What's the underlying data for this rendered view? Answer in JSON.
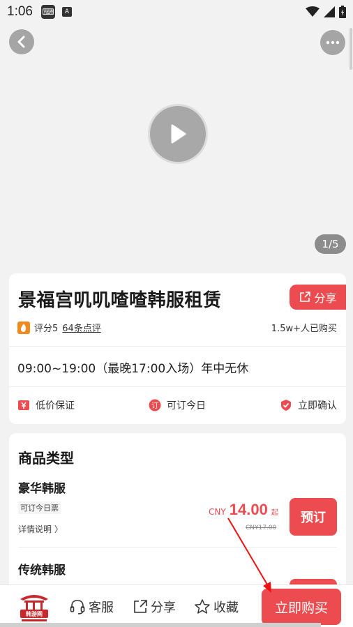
{
  "status_bar": {
    "time": "1:06",
    "icons": [
      "keyboard-icon",
      "a-icon"
    ],
    "right_icons": [
      "wifi-icon",
      "signal-icon",
      "battery-icon"
    ]
  },
  "media": {
    "page_indicator": "1/5"
  },
  "info": {
    "title": "景福宫叽叽喳喳韩服租赁",
    "share_label": "分享",
    "rating": "评分5",
    "reviews": "64条点评",
    "sold": "1.5w+人已购买",
    "hours": "09:00~19:00（最晚17:00入场）年中无休",
    "guarantees": [
      "低价保证",
      "可订今日",
      "立即确认"
    ]
  },
  "products": {
    "section_title": "商品类型",
    "items": [
      {
        "name": "豪华韩服",
        "tag": "可订今日票",
        "detail": "详情说明 〉",
        "currency": "CNY",
        "price": "14.00",
        "price_suffix": "起",
        "original_price": "CNY17.00",
        "book_label": "预订"
      },
      {
        "name": "传统韩服"
      }
    ]
  },
  "bottom_bar": {
    "service_label": "客服",
    "share_label": "分享",
    "favorite_label": "收藏",
    "buy_label": "立即购买"
  },
  "colors": {
    "accent": "#ec4b4f",
    "background": "#f2f2f2"
  }
}
